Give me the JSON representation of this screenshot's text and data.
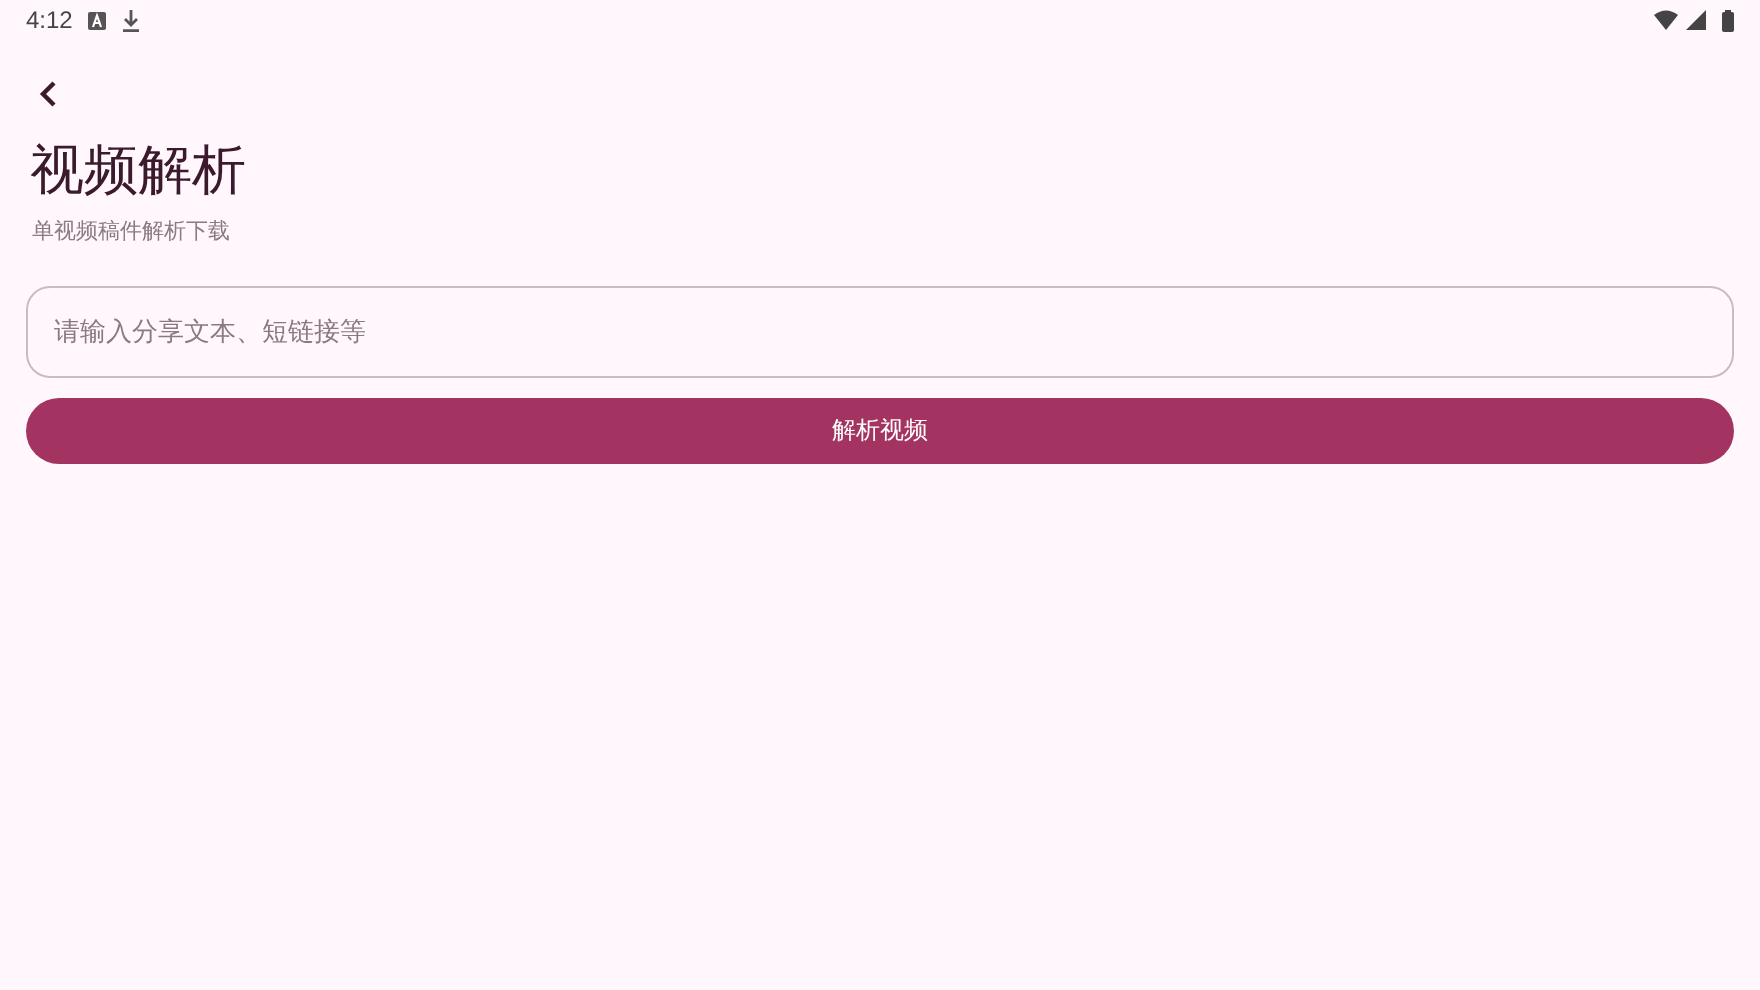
{
  "status_bar": {
    "time": "4:12"
  },
  "header": {
    "title": "视频解析",
    "subtitle": "单视频稿件解析下载"
  },
  "input": {
    "placeholder": "请输入分享文本、短链接等"
  },
  "button": {
    "label": "解析视频"
  }
}
